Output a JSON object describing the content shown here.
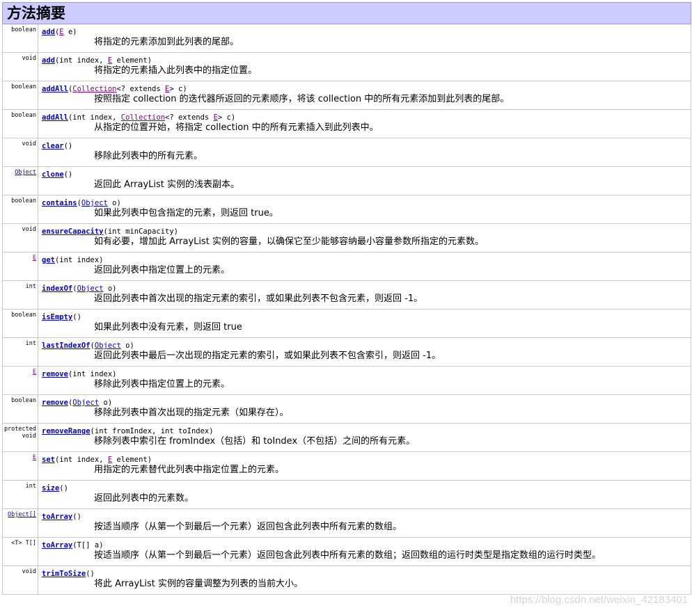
{
  "title": "方法摘要",
  "methods": [
    {
      "ret": "boolean",
      "ret_link": false,
      "name": "add",
      "sig": [
        {
          "t": "(",
          "c": "text"
        },
        {
          "t": "E",
          "c": "plink purple"
        },
        {
          "t": " e)",
          "c": "text"
        }
      ],
      "desc": "将指定的元素添加到此列表的尾部。"
    },
    {
      "ret": "void",
      "ret_link": false,
      "name": "add",
      "sig": [
        {
          "t": "(int index, ",
          "c": "text"
        },
        {
          "t": "E",
          "c": "plink purple"
        },
        {
          "t": " element)",
          "c": "text"
        }
      ],
      "desc": "将指定的元素插入此列表中的指定位置。"
    },
    {
      "ret": "boolean",
      "ret_link": false,
      "name": "addAll",
      "sig": [
        {
          "t": "(",
          "c": "text"
        },
        {
          "t": "Collection",
          "c": "plink purple"
        },
        {
          "t": "<? extends ",
          "c": "text"
        },
        {
          "t": "E",
          "c": "plink purple"
        },
        {
          "t": "> c)",
          "c": "text"
        }
      ],
      "desc": "按照指定 collection 的迭代器所返回的元素顺序，将该 collection 中的所有元素添加到此列表的尾部。"
    },
    {
      "ret": "boolean",
      "ret_link": false,
      "name": "addAll",
      "sig": [
        {
          "t": "(int index, ",
          "c": "text"
        },
        {
          "t": "Collection",
          "c": "plink purple"
        },
        {
          "t": "<? extends ",
          "c": "text"
        },
        {
          "t": "E",
          "c": "plink purple"
        },
        {
          "t": "> c)",
          "c": "text"
        }
      ],
      "desc": "从指定的位置开始，将指定 collection 中的所有元素插入到此列表中。"
    },
    {
      "ret": "void",
      "ret_link": false,
      "name": "clear",
      "sig": [
        {
          "t": "()",
          "c": "text"
        }
      ],
      "desc": "移除此列表中的所有元素。"
    },
    {
      "ret": "Object",
      "ret_link": true,
      "name": "clone",
      "sig": [
        {
          "t": "()",
          "c": "text"
        }
      ],
      "desc": "返回此 ArrayList 实例的浅表副本。"
    },
    {
      "ret": "boolean",
      "ret_link": false,
      "name": "contains",
      "sig": [
        {
          "t": "(",
          "c": "text"
        },
        {
          "t": "Object",
          "c": "plink"
        },
        {
          "t": " o)",
          "c": "text"
        }
      ],
      "desc": "如果此列表中包含指定的元素，则返回 true。"
    },
    {
      "ret": "void",
      "ret_link": false,
      "name": "ensureCapacity",
      "sig": [
        {
          "t": "(int minCapacity)",
          "c": "text"
        }
      ],
      "desc": "如有必要，增加此 ArrayList 实例的容量，以确保它至少能够容纳最小容量参数所指定的元素数。"
    },
    {
      "ret": "E",
      "ret_link": true,
      "ret_purple": true,
      "name": "get",
      "sig": [
        {
          "t": "(int index)",
          "c": "text"
        }
      ],
      "desc": "返回此列表中指定位置上的元素。"
    },
    {
      "ret": "int",
      "ret_link": false,
      "name": "indexOf",
      "sig": [
        {
          "t": "(",
          "c": "text"
        },
        {
          "t": "Object",
          "c": "plink"
        },
        {
          "t": " o)",
          "c": "text"
        }
      ],
      "desc": "返回此列表中首次出现的指定元素的索引，或如果此列表不包含元素，则返回 -1。"
    },
    {
      "ret": "boolean",
      "ret_link": false,
      "name": "isEmpty",
      "sig": [
        {
          "t": "()",
          "c": "text"
        }
      ],
      "desc": "如果此列表中没有元素，则返回 true"
    },
    {
      "ret": "int",
      "ret_link": false,
      "name": "lastIndexOf",
      "sig": [
        {
          "t": "(",
          "c": "text"
        },
        {
          "t": "Object",
          "c": "plink"
        },
        {
          "t": " o)",
          "c": "text"
        }
      ],
      "desc": "返回此列表中最后一次出现的指定元素的索引，或如果此列表不包含索引，则返回 -1。"
    },
    {
      "ret": "E",
      "ret_link": true,
      "ret_purple": true,
      "name": "remove",
      "sig": [
        {
          "t": "(int index)",
          "c": "text"
        }
      ],
      "desc": "移除此列表中指定位置上的元素。"
    },
    {
      "ret": "boolean",
      "ret_link": false,
      "name": "remove",
      "sig": [
        {
          "t": "(",
          "c": "text"
        },
        {
          "t": "Object",
          "c": "plink"
        },
        {
          "t": " o)",
          "c": "text"
        }
      ],
      "desc": "移除此列表中首次出现的指定元素（如果存在）。"
    },
    {
      "ret": "protected void",
      "ret_link": false,
      "name": "removeRange",
      "sig": [
        {
          "t": "(int fromIndex, int toIndex)",
          "c": "text"
        }
      ],
      "desc": "移除列表中索引在 fromIndex（包括）和 toIndex（不包括）之间的所有元素。"
    },
    {
      "ret": "E",
      "ret_link": true,
      "ret_purple": true,
      "name": "set",
      "sig": [
        {
          "t": "(int index, ",
          "c": "text"
        },
        {
          "t": "E",
          "c": "plink purple"
        },
        {
          "t": " element)",
          "c": "text"
        }
      ],
      "desc": "用指定的元素替代此列表中指定位置上的元素。"
    },
    {
      "ret": "int",
      "ret_link": false,
      "name": "size",
      "sig": [
        {
          "t": "()",
          "c": "text"
        }
      ],
      "desc": "返回此列表中的元素数。"
    },
    {
      "ret": "Object[]",
      "ret_link": true,
      "name": "toArray",
      "sig": [
        {
          "t": "()",
          "c": "text"
        }
      ],
      "desc": "按适当顺序（从第一个到最后一个元素）返回包含此列表中所有元素的数组。"
    },
    {
      "ret": "<T> T[]",
      "ret_link": false,
      "name": "toArray",
      "sig": [
        {
          "t": "(T[] a)",
          "c": "text"
        }
      ],
      "desc": "按适当顺序（从第一个到最后一个元素）返回包含此列表中所有元素的数组；返回数组的运行时类型是指定数组的运行时类型。"
    },
    {
      "ret": "void",
      "ret_link": false,
      "name": "trimToSize",
      "sig": [
        {
          "t": "()",
          "c": "text"
        }
      ],
      "desc": "将此 ArrayList 实例的容量调整为列表的当前大小。"
    }
  ],
  "watermark": "https://blog.csdn.net/weixin_42183401"
}
